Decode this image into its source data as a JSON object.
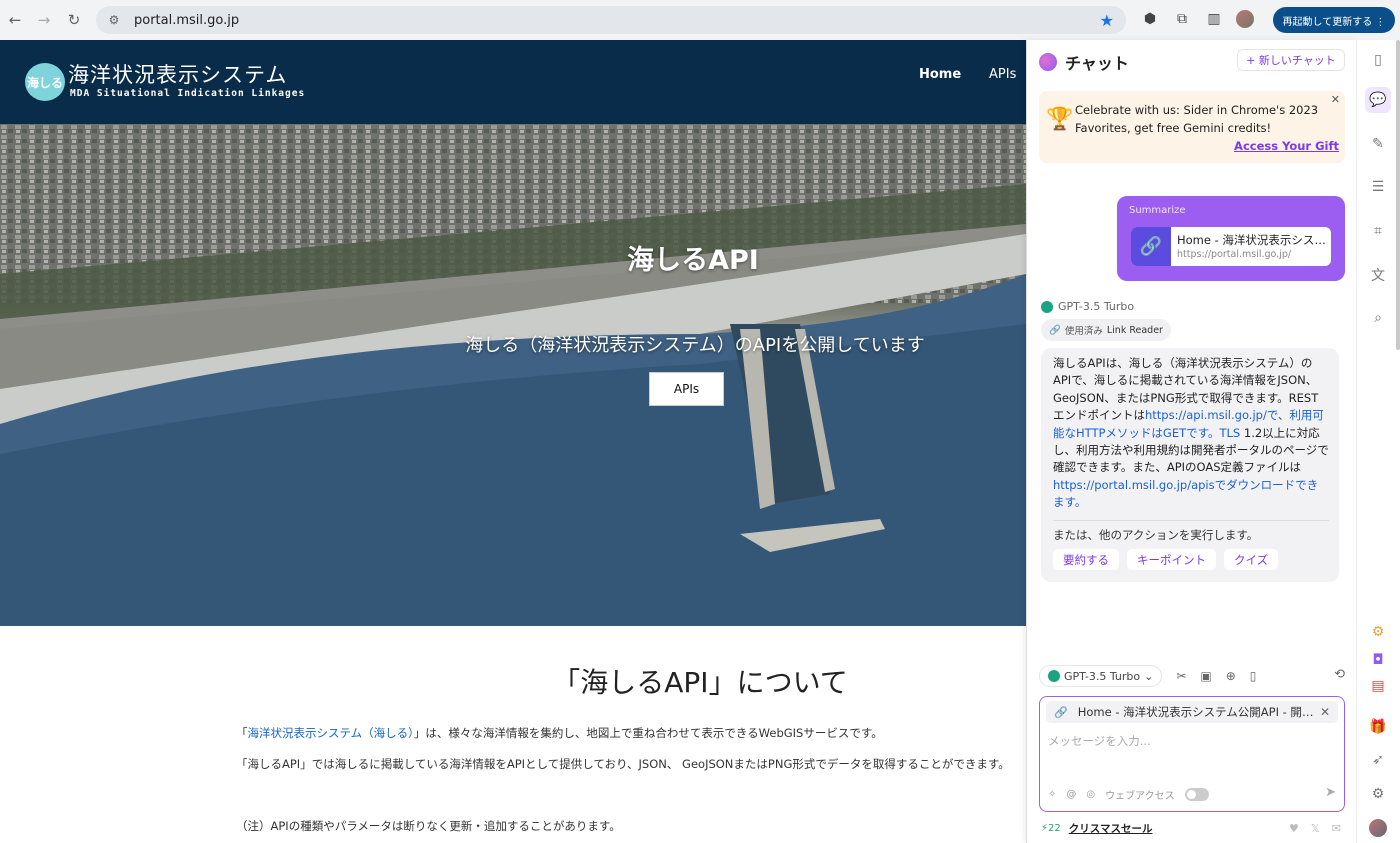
{
  "browser": {
    "url": "portal.msil.go.jp",
    "relaunch_label": "再起動して更新する ⋮"
  },
  "site": {
    "logo_mark": "海しる",
    "logo_title": "海洋状況表示システム",
    "logo_subtitle": "MDA Situational Indication Linkages",
    "nav": {
      "home": "Home",
      "apis": "APIs"
    }
  },
  "hero": {
    "title": "海しるAPI",
    "subtitle": "海しる（海洋状況表示システム）のAPIを公開しています",
    "button": "APIs"
  },
  "about": {
    "title": "「海しるAPI」について",
    "p1_pre": "「",
    "p1_link": "海洋状況表示システム（海しる）",
    "p1_post": "」は、様々な海洋情報を集約し、地図上で重ね合わせて表示できるWebGISサービスです。",
    "p2": "「海しるAPI」では海しるに掲載している海洋情報をAPIとして提供しており、JSON、 GeoJSONまたはPNG形式でデータを取得することができます。",
    "note": "（注）APIの種類やパラメータは断りなく更新・追加することがあります。"
  },
  "sider": {
    "title": "チャット",
    "new_chat": "+ 新しいチャット",
    "promo_text": "Celebrate with us: Sider in Chrome's 2023 Favorites, get free Gemini credits!",
    "promo_link": "Access Your Gift",
    "summarize_label": "Summarize",
    "link_title": "Home - 海洋状況表示システム公開API",
    "link_url": "https://portal.msil.go.jp/",
    "model": "GPT-3.5 Turbo",
    "used_prefix": "使用済み",
    "used_tool": "Link Reader",
    "answer_1": "海しるAPIは、海しる（海洋状況表示システム）のAPIで、海しるに掲載されている海洋情報をJSON、GeoJSON、またはPNG形式で取得できます。RESTエンドポイントは",
    "answer_link1": "https://api.msil.go.jp/で、利用可能なHTTPメソッドはGETです。TLS",
    "answer_2": " 1.2以上に対応し、利用方法や利用規約は開発者ポータルのページで確認できます。また、APIのOAS定義ファイルは",
    "answer_link2": "https://portal.msil.go.jp/apisでダウンロードできます。",
    "other_actions": "または、他のアクションを実行します。",
    "actions": [
      "要約する",
      "キーポイント",
      "クイズ"
    ],
    "composer_model": "GPT-3.5 Turbo",
    "attach_title": "Home - 海洋状況表示システム公開API - 開発者ポータル",
    "placeholder": "メッセージを入力...",
    "web_access": "ウェブアクセス",
    "credits": "22",
    "promo_footer": "クリスマスセール"
  }
}
